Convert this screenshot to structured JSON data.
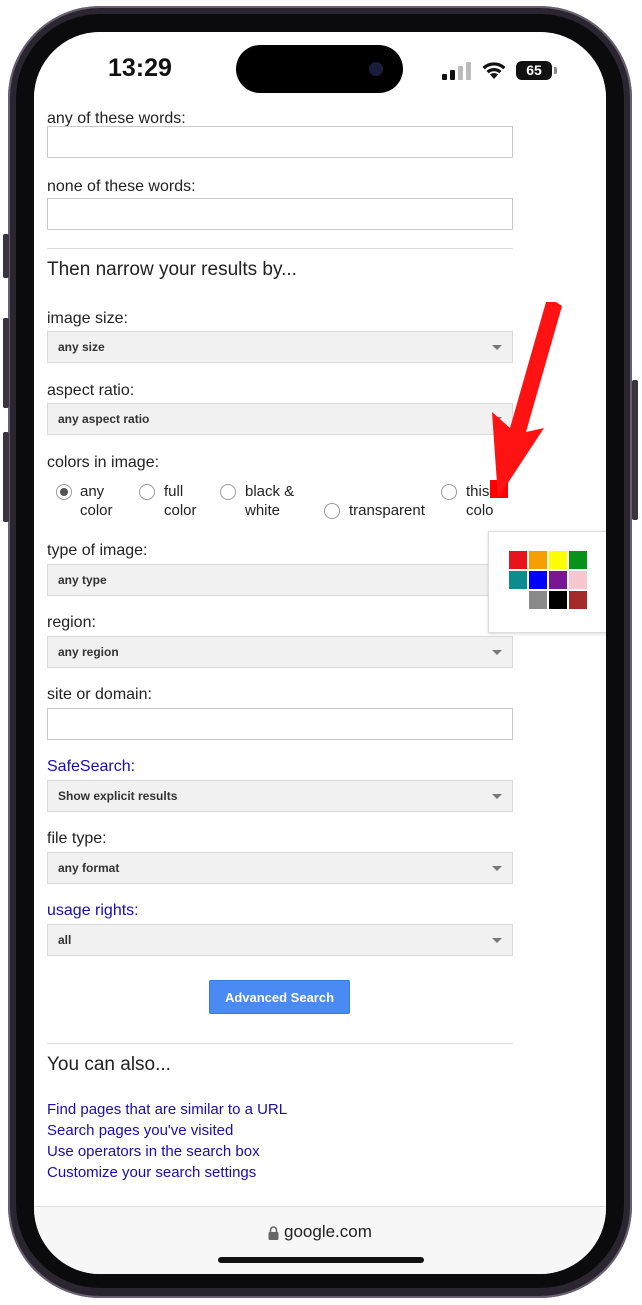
{
  "status": {
    "time": "13:29",
    "battery": "65"
  },
  "form": {
    "any_words_label": "any of these words:",
    "none_words_label": "none of these words:",
    "narrow_heading": "Then narrow your results by...",
    "image_size": {
      "label": "image size:",
      "value": "any size"
    },
    "aspect_ratio": {
      "label": "aspect ratio:",
      "value": "any aspect ratio"
    },
    "colors": {
      "label": "colors in image:",
      "options": [
        {
          "line1": "any",
          "line2": "color",
          "checked": true
        },
        {
          "line1": "full",
          "line2": "color",
          "checked": false
        },
        {
          "line1": "black &",
          "line2": "white",
          "checked": false
        },
        {
          "line1": "transparent",
          "line2": "",
          "checked": false
        },
        {
          "line1": "this",
          "line2": "colo",
          "checked": false
        }
      ],
      "selected_swatch": "#ff0000",
      "palette": [
        "#e8141b",
        "#f59f00",
        "#ffff00",
        "#08921b",
        "#0b8d8e",
        "#0000ff",
        "#7a1693",
        "#f6c7d0",
        "#ffffff",
        "#8a8a8a",
        "#000000",
        "#a52a2a"
      ]
    },
    "type_of_image": {
      "label": "type of image:",
      "value": "any type"
    },
    "region": {
      "label": "region:",
      "value": "any region"
    },
    "site_label": "site or domain:",
    "safesearch": {
      "label": "SafeSearch:",
      "value": "Show explicit results"
    },
    "file_type": {
      "label": "file type:",
      "value": "any format"
    },
    "usage_rights": {
      "label": "usage rights:",
      "value": "all"
    },
    "submit_label": "Advanced Search"
  },
  "also": {
    "heading": "You can also...",
    "links": [
      "Find pages that are similar to a URL",
      "Search pages you've visited",
      "Use operators in the search box",
      "Customize your search settings"
    ]
  },
  "browser": {
    "url": "google.com"
  },
  "annotation_color": "#ff0000"
}
